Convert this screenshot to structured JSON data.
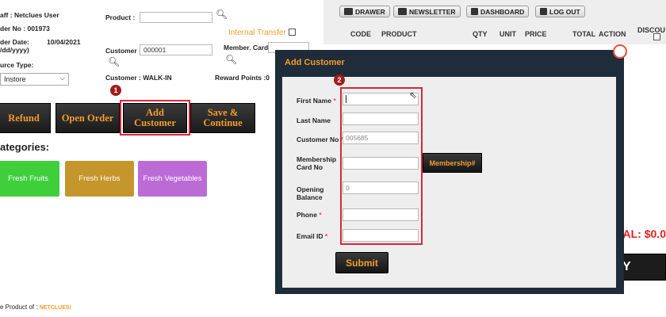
{
  "left_panel": {
    "staff": "aff : Netclues User",
    "order_no": "der No : 001973",
    "order_date_label": "der Date:",
    "order_date_hint": "/dd/yyyy)",
    "order_date_value": "10/04/2021",
    "source_type_label": "urce Type:",
    "source_type_value": "Instore",
    "product_label": "Product :",
    "internal_transfer": "Internal Transfer",
    "customer_label": "Customer :",
    "customer_value": "000001",
    "member_card_label": "Member. Card:",
    "customer_walkin": "Customer : WALK-IN",
    "reward_points": "Reward Points :0",
    "badge_1": "1"
  },
  "actions": {
    "refund": "Refund",
    "open_order": "Open Order",
    "add_customer_line1": "Add",
    "add_customer_line2": "Customer",
    "save_continue_line1": "Save &",
    "save_continue_line2": "Continue"
  },
  "categories": {
    "heading": "ategories:",
    "items": [
      {
        "label": "Fresh Fruits",
        "color": "#3fcf3b"
      },
      {
        "label": "Fresh Herbs",
        "color": "#c4962b"
      },
      {
        "label": "Fresh Vegetables",
        "color": "#bb6bd6"
      }
    ]
  },
  "footer": {
    "product_of": "e Product of :",
    "brand": "NETCLUES!"
  },
  "top_nav": {
    "drawer": "DRAWER",
    "newsletter": "NEWSLETTER",
    "dashboard": "DASHBOARD",
    "logout": "LOG OUT"
  },
  "table_headers": {
    "code": "CODE",
    "product": "PRODUCT",
    "qty": "QTY",
    "unit": "UNIT",
    "price": "PRICE",
    "total": "TOTAL",
    "action": "ACTION",
    "discount": "DISCOU"
  },
  "right_panel": {
    "total_partial": "TAL: $0.0",
    "pay_partial": "Y"
  },
  "modal": {
    "title": "Add Customer",
    "badge_2": "2",
    "fields": {
      "first_name": "First Name",
      "last_name": "Last Name",
      "customer_no": "Customer No",
      "customer_no_value": "005685",
      "membership_line1": "Membership",
      "membership_line2": "Card No",
      "membership_button": "Membership#",
      "opening_line1": "Opening",
      "opening_line2": "Balance",
      "opening_value": "0",
      "phone": "Phone",
      "email": "Email ID",
      "required_mark": "*"
    },
    "submit": "Submit"
  },
  "colors": {
    "accent_orange": "#f39c2b",
    "highlight_red": "#d6283a",
    "modal_dark": "#1f2c3a",
    "total_red": "#e02020"
  }
}
